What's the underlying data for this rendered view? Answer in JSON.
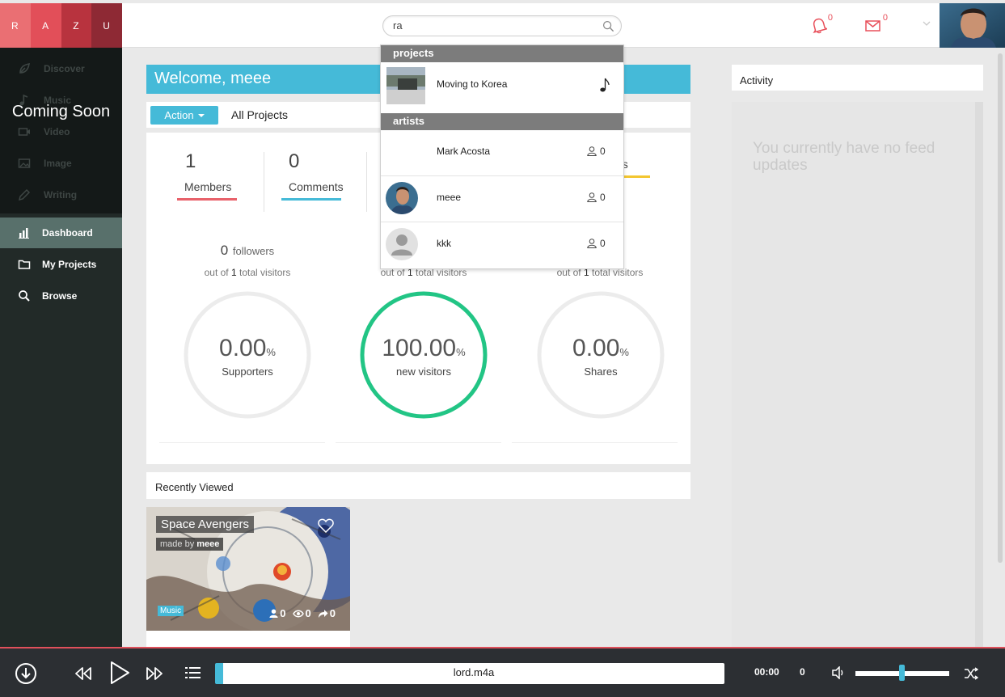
{
  "logo": {
    "letters": [
      "R",
      "A",
      "Z",
      "U"
    ]
  },
  "sidebar": {
    "media_items": [
      "Discover",
      "Music",
      "Video",
      "Image",
      "Writing"
    ],
    "coming_soon": "Coming Soon",
    "nav_items": [
      "Dashboard",
      "My Projects",
      "Browse"
    ],
    "active": "Dashboard"
  },
  "search": {
    "value": "ra"
  },
  "notifications": {
    "bell_count": "0",
    "mail_count": "0"
  },
  "dropdown": {
    "projects_heading": "projects",
    "project_name": "Moving to Korea",
    "artists_heading": "artists",
    "artists": [
      {
        "name": "Mark Acosta",
        "count": "0"
      },
      {
        "name": "meee",
        "count": "0"
      },
      {
        "name": "kkk",
        "count": "0"
      }
    ]
  },
  "main": {
    "welcome": "Welcome, meee",
    "action_label": "Action",
    "all_projects": "All Projects",
    "stats": [
      {
        "num": "1",
        "label": "Members",
        "color": "#e8616a"
      },
      {
        "num": "0",
        "label": "Comments",
        "color": "#45bad8"
      },
      {
        "num": "",
        "label": "es",
        "color": "#f3c630"
      }
    ],
    "followers_count": "0",
    "followers_label": "followers",
    "out_of_prefix": "out of",
    "visitors_count": "1",
    "visitors_label": "total visitors",
    "gauges": [
      {
        "value": "0.00",
        "unit": "%",
        "label": "Supporters",
        "fraction": 0
      },
      {
        "value": "100.00",
        "unit": "%",
        "label": "new visitors",
        "fraction": 1
      },
      {
        "value": "0.00",
        "unit": "%",
        "label": "Shares",
        "fraction": 0
      }
    ],
    "gauge_color": "#22c585",
    "recently_viewed": "Recently Viewed",
    "card": {
      "title": "Space Avengers",
      "made_by": "made by",
      "author": "meee",
      "tag": "Music",
      "likes": "0",
      "views": "0",
      "shares": "0"
    }
  },
  "activity": {
    "title": "Activity",
    "empty": "You currently have no feed updates"
  },
  "player": {
    "track": "lord.m4a",
    "time": "00:00",
    "count": "0",
    "volume": 0.5
  }
}
